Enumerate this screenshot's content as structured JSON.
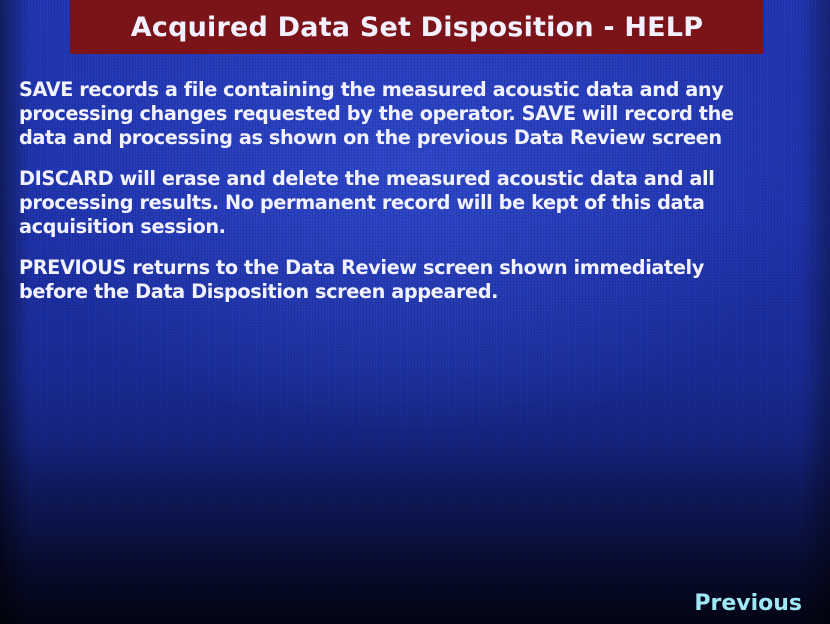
{
  "title": "Acquired Data Set Disposition - HELP",
  "paragraphs": [
    "SAVE records a file containing the measured acoustic data and any\nprocessing changes requested by the operator.  SAVE will record the\ndata and processing as shown on the previous Data Review screen",
    "DISCARD will erase and delete the measured acoustic data and all\nprocessing results.  No permanent record will be kept of this data\nacquisition session.",
    "PREVIOUS returns to the Data Review screen shown immediately\nbefore the Data Disposition screen appeared."
  ],
  "buttons": {
    "previous_label": "Previous"
  },
  "colors": {
    "background": "#2034b0",
    "title_bar": "#7a1418",
    "text": "#f2f2ff",
    "button_text": "#9fe8f6"
  }
}
